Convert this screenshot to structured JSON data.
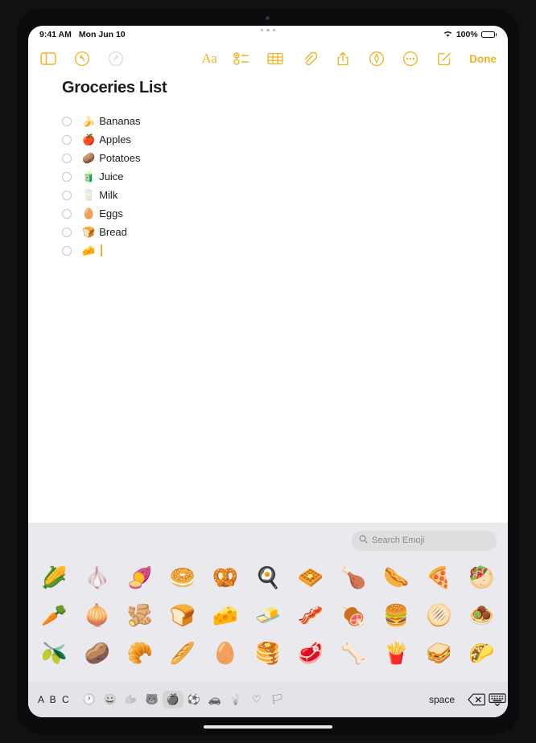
{
  "status_bar": {
    "time": "9:41 AM",
    "date": "Mon Jun 10",
    "battery_percent": "100%",
    "wifi_icon": "wifi-icon"
  },
  "toolbar": {
    "sidebar_icon": "sidebar-icon",
    "undo_icon": "undo-icon",
    "redo_icon": "redo-icon",
    "format_label": "Aa",
    "checklist_icon": "checklist-icon",
    "table_icon": "table-icon",
    "attach_icon": "paperclip-icon",
    "share_icon": "share-icon",
    "markup_icon": "markup-icon",
    "more_icon": "more-icon",
    "compose_icon": "compose-icon",
    "done_label": "Done"
  },
  "note": {
    "title": "Groceries List",
    "items": [
      {
        "emoji": "🍌",
        "text": "Bananas",
        "checked": false
      },
      {
        "emoji": "🍎",
        "text": "Apples",
        "checked": false
      },
      {
        "emoji": "🥔",
        "text": "Potatoes",
        "checked": false
      },
      {
        "emoji": "🧃",
        "text": "Juice",
        "checked": false
      },
      {
        "emoji": "🥛",
        "text": "Milk",
        "checked": false
      },
      {
        "emoji": "🥚",
        "text": "Eggs",
        "checked": false
      },
      {
        "emoji": "🍞",
        "text": "Bread",
        "checked": false
      },
      {
        "emoji": "🧀",
        "text": "",
        "checked": false
      }
    ]
  },
  "keyboard": {
    "search_placeholder": "Search Emoji",
    "search_icon": "search-icon",
    "abc_label": "A B C",
    "space_label": "space",
    "delete_icon": "delete-icon",
    "dismiss_icon": "keyboard-dismiss-icon",
    "categories": [
      {
        "name": "recents",
        "glyph": "🕐",
        "active": false
      },
      {
        "name": "smileys",
        "glyph": "😀",
        "active": false
      },
      {
        "name": "people",
        "glyph": "🫱",
        "active": false
      },
      {
        "name": "animals",
        "glyph": "🐻",
        "active": false
      },
      {
        "name": "food",
        "glyph": "🍎",
        "active": true
      },
      {
        "name": "activities",
        "glyph": "⚽",
        "active": false
      },
      {
        "name": "travel",
        "glyph": "🚗",
        "active": false
      },
      {
        "name": "objects",
        "glyph": "💡",
        "active": false
      },
      {
        "name": "symbols",
        "glyph": "♡",
        "active": false
      },
      {
        "name": "flags",
        "glyph": "🏳",
        "active": false
      }
    ],
    "emoji_grid": [
      "🌽",
      "🧄",
      "🍠",
      "🥯",
      "🥨",
      "🍳",
      "🧇",
      "🍗",
      "🌭",
      "🍕",
      "🥙",
      "🥕",
      "🧅",
      "🫚",
      "🍞",
      "🧀",
      "🧈",
      "🥓",
      "🍖",
      "🍔",
      "🫓",
      "🧆",
      "🫒",
      "🥔",
      "🥐",
      "🥖",
      "🥚",
      "🥞",
      "🥩",
      "🦴",
      "🍟",
      "🥪",
      "🌮"
    ]
  }
}
